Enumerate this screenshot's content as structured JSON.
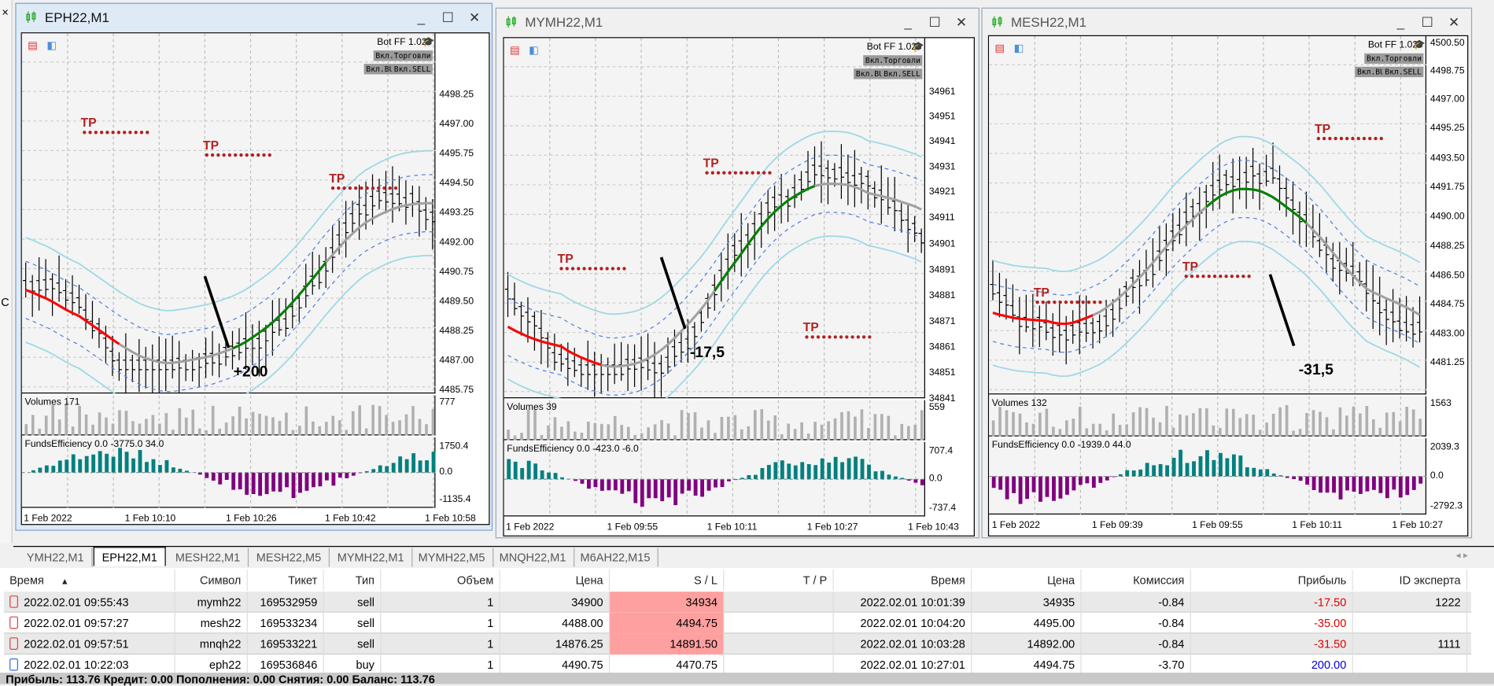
{
  "colors": {
    "bull_ma": "#008000",
    "bear_ma": "#ff0000",
    "neutral_ma": "#a0a0a0",
    "bands": "#9fd8e6",
    "tp": "#b22222",
    "pos_hist": "#008080",
    "neg_hist": "#800080",
    "sl_highlight": "#ffa0a0",
    "loss": "#e00000",
    "profit": "#0000e0"
  },
  "charts": [
    {
      "title": "EPH22,M1",
      "active": true,
      "bot": "Bot FF 1.02",
      "btn_trade": "Вкл.Торговли",
      "btn_buy": "Вкл.BUY",
      "btn_sell": "Вкл.SELL",
      "prices": [
        "4498.25",
        "4497.00",
        "4495.75",
        "4494.50",
        "4493.25",
        "4492.00",
        "4490.75",
        "4489.50",
        "4488.25",
        "4487.00",
        "4485.75"
      ],
      "volumes_label": "Volumes 171",
      "volumes_max": "777",
      "ind_label": "FundsEfficiency 0.0 -3775.0 34.0",
      "ind_ticks": [
        "1750.4",
        "0.0",
        "-1135.4"
      ],
      "times": [
        "1 Feb 2022",
        "1 Feb 10:10",
        "1 Feb 10:26",
        "1 Feb 10:42",
        "1 Feb 10:58"
      ],
      "annotation": "+200",
      "tp": "TP"
    },
    {
      "title": "MYMH22,M1",
      "active": false,
      "bot": "Bot FF 1.02",
      "btn_trade": "Вкл.Торговли",
      "btn_buy": "Вкл.BUY",
      "btn_sell": "Вкл.SELL",
      "prices": [
        "34961",
        "34951",
        "34941",
        "34931",
        "34921",
        "34911",
        "34901",
        "34891",
        "34881",
        "34871",
        "34861",
        "34851",
        "34841"
      ],
      "volumes_label": "Volumes 39",
      "volumes_max": "559",
      "ind_label": "FundsEfficiency 0.0 -423.0 -6.0",
      "ind_ticks": [
        "707.4",
        "0.0",
        "-737.4"
      ],
      "times": [
        "1 Feb 2022",
        "1 Feb 09:55",
        "1 Feb 10:11",
        "1 Feb 10:27",
        "1 Feb 10:43"
      ],
      "annotation": "-17,5",
      "tp": "TP"
    },
    {
      "title": "MESH22,M1",
      "active": false,
      "bot": "Bot FF 1.02",
      "btn_trade": "Вкл.Торговли",
      "btn_buy": "Вкл.BUY",
      "btn_sell": "Вкл.SELL",
      "prices": [
        "4500.50",
        "4498.75",
        "4497.00",
        "4495.25",
        "4493.50",
        "4491.75",
        "4490.00",
        "4488.25",
        "4486.50",
        "4484.75",
        "4483.00",
        "4481.25"
      ],
      "volumes_label": "Volumes 132",
      "volumes_max": "1563",
      "ind_label": "FundsEfficiency 0.0 -1939.0 44.0",
      "ind_ticks": [
        "2039.3",
        "0.0",
        "-2792.3"
      ],
      "times": [
        "1 Feb 2022",
        "1 Feb 09:39",
        "1 Feb 09:55",
        "1 Feb 10:11",
        "1 Feb 10:27"
      ],
      "annotation": "-31,5",
      "tp": "TP"
    }
  ],
  "left_strip": {
    "close": "×",
    "letter": "C"
  },
  "tabs": [
    "YMH22,M1",
    "EPH22,M1",
    "MESH22,M1",
    "MESH22,M5",
    "MYMH22,M1",
    "MYMH22,M5",
    "MNQH22,M1",
    "M6AH22,M15"
  ],
  "active_tab": "EPH22,M1",
  "table": {
    "headers": [
      "Время",
      "Символ",
      "Тикет",
      "Тип",
      "Объем",
      "Цена",
      "S / L",
      "T / P",
      "Время",
      "Цена",
      "Комиссия",
      "Прибыль",
      "ID эксперта"
    ],
    "sort_indicator": "▲",
    "rows": [
      {
        "type": "sell",
        "cells": [
          "2022.02.01 09:55:43",
          "mymh22",
          "169532959",
          "sell",
          "1",
          "34900",
          "34934",
          "",
          "2022.02.01 10:01:39",
          "34935",
          "-0.84",
          "-17.50",
          "1222"
        ]
      },
      {
        "type": "sell",
        "cells": [
          "2022.02.01 09:57:27",
          "mesh22",
          "169533234",
          "sell",
          "1",
          "4488.00",
          "4494.75",
          "",
          "2022.02.01 10:04:20",
          "4495.00",
          "-0.84",
          "-35.00",
          ""
        ]
      },
      {
        "type": "sell",
        "cells": [
          "2022.02.01 09:57:51",
          "mnqh22",
          "169533221",
          "sell",
          "1",
          "14876.25",
          "14891.50",
          "",
          "2022.02.01 10:03:28",
          "14892.00",
          "-0.84",
          "-31.50",
          "1111"
        ]
      },
      {
        "type": "buy",
        "cells": [
          "2022.02.01 10:22:03",
          "eph22",
          "169536846",
          "buy",
          "1",
          "4490.75",
          "4470.75",
          "",
          "2022.02.01 10:27:01",
          "4494.75",
          "-3.70",
          "200.00",
          ""
        ]
      }
    ],
    "summary": "Прибыль: 113.76  Кредит: 0.00  Пополнения: 0.00  Снятия: 0.00  Баланс: 113.76"
  }
}
